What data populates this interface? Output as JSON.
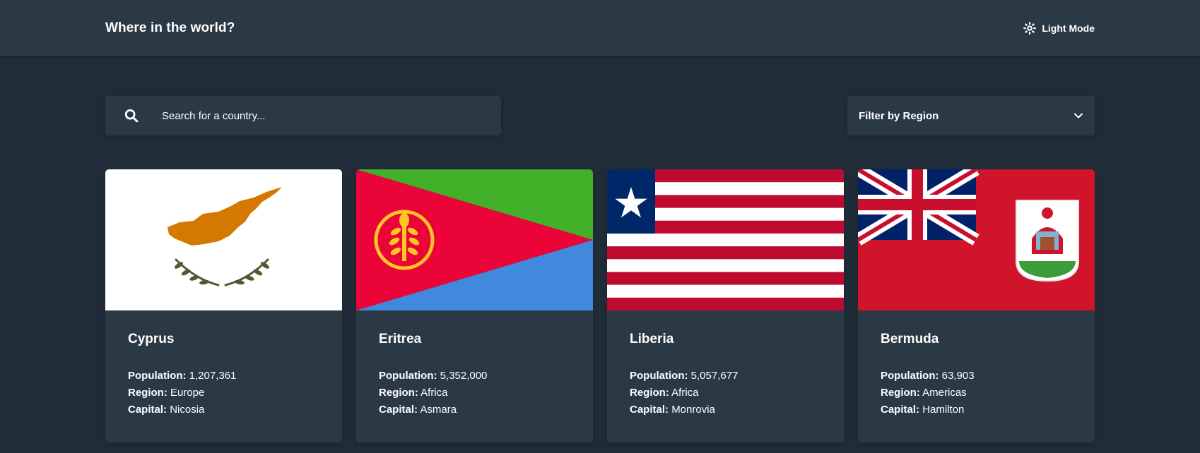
{
  "header": {
    "title": "Where in the world?",
    "mode_label": "Light Mode",
    "mode_icon": "sun-icon"
  },
  "search": {
    "placeholder": "Search for a country...",
    "value": "",
    "icon": "search-icon"
  },
  "filter": {
    "label": "Filter by Region",
    "icon": "chevron-down-icon"
  },
  "labels": {
    "population": "Population:",
    "region": "Region:",
    "capital": "Capital:"
  },
  "countries": [
    {
      "name": "Cyprus",
      "population": "1,207,361",
      "region": "Europe",
      "capital": "Nicosia",
      "flag": "cyprus-flag"
    },
    {
      "name": "Eritrea",
      "population": "5,352,000",
      "region": "Africa",
      "capital": "Asmara",
      "flag": "eritrea-flag"
    },
    {
      "name": "Liberia",
      "population": "5,057,677",
      "region": "Africa",
      "capital": "Monrovia",
      "flag": "liberia-flag"
    },
    {
      "name": "Bermuda",
      "population": "63,903",
      "region": "Americas",
      "capital": "Hamilton",
      "flag": "bermuda-flag"
    }
  ],
  "colors": {
    "background": "#202c37",
    "element": "#2b3945",
    "text": "#ffffff"
  }
}
